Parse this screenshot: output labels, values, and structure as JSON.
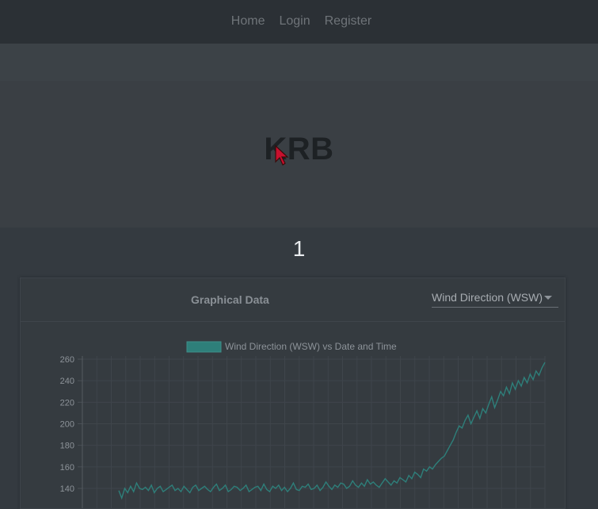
{
  "nav": {
    "links": [
      "Home",
      "Login",
      "Register"
    ]
  },
  "hero": {
    "title": "KRB"
  },
  "page_number": "1",
  "card": {
    "title": "Graphical Data",
    "select": {
      "value": "Wind Direction (WSW)"
    }
  },
  "colors": {
    "navbar": "#2b3035",
    "background": "#343a40",
    "series": "#2e7f7a",
    "legend_swatch": "#2e7f7a"
  },
  "chart_data": {
    "type": "line",
    "title": "",
    "legend": [
      "Wind Direction (WSW) vs Date and Time"
    ],
    "yticks": [
      140,
      160,
      180,
      200,
      220,
      240,
      260
    ],
    "ylim": [
      130,
      262
    ],
    "grid": true,
    "series": [
      {
        "name": "Wind Direction (WSW) vs Date and Time",
        "values": [
          138,
          131,
          140,
          136,
          142,
          137,
          145,
          140,
          139,
          141,
          138,
          143,
          136,
          140,
          142,
          137,
          139,
          141,
          143,
          138,
          140,
          137,
          142,
          139,
          136,
          141,
          143,
          138,
          140,
          142,
          139,
          137,
          141,
          144,
          138,
          140,
          143,
          137,
          139,
          142,
          141,
          138,
          140,
          143,
          137,
          139,
          141,
          142,
          138,
          144,
          139,
          137,
          142,
          140,
          143,
          138,
          141,
          137,
          140,
          145,
          139,
          138,
          142,
          141,
          144,
          139,
          140,
          143,
          138,
          141,
          146,
          142,
          139,
          143,
          141,
          145,
          144,
          140,
          142,
          147,
          143,
          141,
          145,
          142,
          148,
          144,
          146,
          143,
          141,
          145,
          149,
          146,
          143,
          147,
          145,
          150,
          148,
          146,
          152,
          149,
          155,
          153,
          150,
          158,
          156,
          160,
          158,
          162,
          165,
          168,
          170,
          175,
          180,
          185,
          192,
          198,
          196,
          203,
          208,
          200,
          206,
          212,
          205,
          214,
          210,
          218,
          225,
          215,
          222,
          230,
          226,
          234,
          228,
          238,
          232,
          240,
          235,
          243,
          238,
          246,
          241,
          249,
          245,
          252,
          257
        ]
      }
    ]
  }
}
